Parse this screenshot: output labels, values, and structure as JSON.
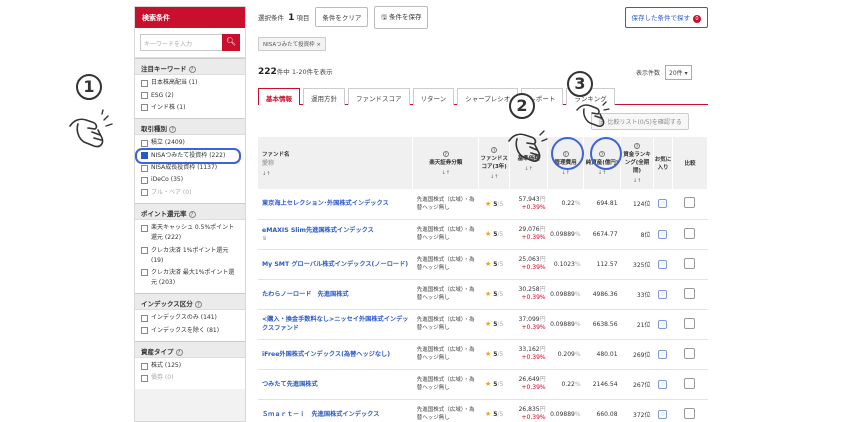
{
  "sidebar": {
    "title": "検索条件",
    "keyword_placeholder": "キーワードを入力",
    "search_icon": "search-icon",
    "sections": [
      {
        "title": "注目キーワード",
        "items": [
          {
            "label": "日本株高配当 (1)",
            "checked": false
          },
          {
            "label": "ESG (2)",
            "checked": false
          },
          {
            "label": "インド株 (1)",
            "checked": false
          }
        ]
      },
      {
        "title": "取引種別",
        "items": [
          {
            "label": "積立 (2409)",
            "checked": false
          },
          {
            "label": "NISAつみたて投資枠 (222)",
            "checked": true
          },
          {
            "label": "NISA成長投資枠 (1137)",
            "checked": false
          },
          {
            "label": "iDeCo (35)",
            "checked": false
          },
          {
            "label": "ブル・ベア (0)",
            "checked": false,
            "dim": true
          }
        ]
      },
      {
        "title": "ポイント還元率",
        "items": [
          {
            "label": "楽天キャッシュ 0.5%ポイント還元 (222)",
            "checked": false
          },
          {
            "label": "クレカ決済 1%ポイント還元 (19)",
            "checked": false
          },
          {
            "label": "クレカ決済 最大1%ポイント還元 (203)",
            "checked": false
          }
        ]
      },
      {
        "title": "インデックス区分",
        "items": [
          {
            "label": "インデックスのみ (141)",
            "checked": false
          },
          {
            "label": "インデックスを除く (81)",
            "checked": false
          }
        ]
      },
      {
        "title": "資産タイプ",
        "items": [
          {
            "label": "株式 (125)",
            "checked": false
          },
          {
            "label": "債券 (0)",
            "checked": false,
            "dim": true
          }
        ]
      }
    ]
  },
  "topbar": {
    "selected_label": "選択条件",
    "selected_count": "1",
    "selected_unit": "項目",
    "clear_label": "条件をクリア",
    "save_label": "条件を保存",
    "saved_search_label": "保存した条件で探す",
    "saved_count": "0"
  },
  "chip": "NISAつみたて投資枠 ×",
  "results": {
    "total": "222",
    "unit": "件中",
    "range": "1-20件を表示",
    "per_page_label": "表示件数",
    "per_page_value": "20件"
  },
  "tabs": [
    "基本情報",
    "運用方針",
    "ファンドスコア",
    "リターン",
    "シャープレシオ",
    "レポート",
    "ランキング"
  ],
  "compare_button": "比較リスト(0/5)を確認する",
  "table": {
    "headers": {
      "name": "ファンド名",
      "name_sub": "愛称",
      "category": "楽天証券分類",
      "score": "ファンドスコア(3年)",
      "price": "基準価額",
      "fee": "管理費用",
      "assets": "純資産(億円)",
      "ranking": "資金ランキング(全期間)",
      "favorite": "お気に入り",
      "compare": "比較",
      "sort": "↓↑"
    },
    "rows": [
      {
        "name": "東京海上セレクション･外国株式インデックス",
        "sub": "",
        "category": "先進国株式（広域）・為替ヘッジ無し",
        "score": "5",
        "score_max": "/5",
        "price": "57,943",
        "price_unit": "円",
        "change": "+0.39%",
        "fee": "0.22",
        "assets": "694.81",
        "rank": "124位"
      },
      {
        "name": "eMAXIS Slim先進国株式インデックス",
        "sub": "♛",
        "category": "先進国株式（広域）・為替ヘッジ無し",
        "score": "5",
        "score_max": "/5",
        "price": "29,076",
        "price_unit": "円",
        "change": "+0.39%",
        "fee": "0.09889",
        "assets": "6674.77",
        "rank": "8位"
      },
      {
        "name": "My SMT グローバル株式インデックス(ノーロード)",
        "sub": "",
        "category": "先進国株式（広域）・為替ヘッジ無し",
        "score": "5",
        "score_max": "/5",
        "price": "25,063",
        "price_unit": "円",
        "change": "+0.39%",
        "fee": "0.1023",
        "assets": "112.57",
        "rank": "325位"
      },
      {
        "name": "たわらノーロード　先進国株式",
        "sub": "",
        "category": "先進国株式（広域）・為替ヘッジ無し",
        "score": "5",
        "score_max": "/5",
        "price": "30,258",
        "price_unit": "円",
        "change": "+0.39%",
        "fee": "0.09889",
        "assets": "4986.36",
        "rank": "33位"
      },
      {
        "name": "<購入・換金手数料なし>ニッセイ外国株式インデックスファンド",
        "sub": "",
        "category": "先進国株式（広域）・為替ヘッジ無し",
        "score": "5",
        "score_max": "/5",
        "price": "37,099",
        "price_unit": "円",
        "change": "+0.39%",
        "fee": "0.09889",
        "assets": "6638.56",
        "rank": "21位"
      },
      {
        "name": "iFree外国株式インデックス(為替ヘッジなし)",
        "sub": "",
        "category": "先進国株式（広域）・為替ヘッジ無し",
        "score": "5",
        "score_max": "/5",
        "price": "33,162",
        "price_unit": "円",
        "change": "+0.39%",
        "fee": "0.209",
        "assets": "480.01",
        "rank": "269位"
      },
      {
        "name": "つみたて先進国株式",
        "sub": "",
        "category": "先進国株式（広域）・為替ヘッジ無し",
        "score": "5",
        "score_max": "/5",
        "price": "26,649",
        "price_unit": "円",
        "change": "+0.39%",
        "fee": "0.22",
        "assets": "2146.54",
        "rank": "267位"
      },
      {
        "name": "Ｓｍａｒｔ－ｉ　先進国株式インデックス",
        "sub": "",
        "category": "先進国株式（広域）・為替ヘッジ無し",
        "score": "5",
        "score_max": "/5",
        "price": "26,835",
        "price_unit": "円",
        "change": "+0.39%",
        "fee": "0.09889",
        "assets": "660.08",
        "rank": "372位"
      }
    ],
    "fee_unit": "%"
  },
  "annotations": [
    "1",
    "2",
    "3"
  ],
  "colors": {
    "brand_red": "#c8102e",
    "link_blue": "#2b58c9",
    "highlight_blue": "#3d63d6",
    "star_gold": "#f0a500",
    "up_red": "#d0021b"
  },
  "icons": {
    "favorite": "heart-icon",
    "save": "save-icon",
    "help": "question-circle-icon",
    "pointer": "hand-pointer-icon"
  }
}
